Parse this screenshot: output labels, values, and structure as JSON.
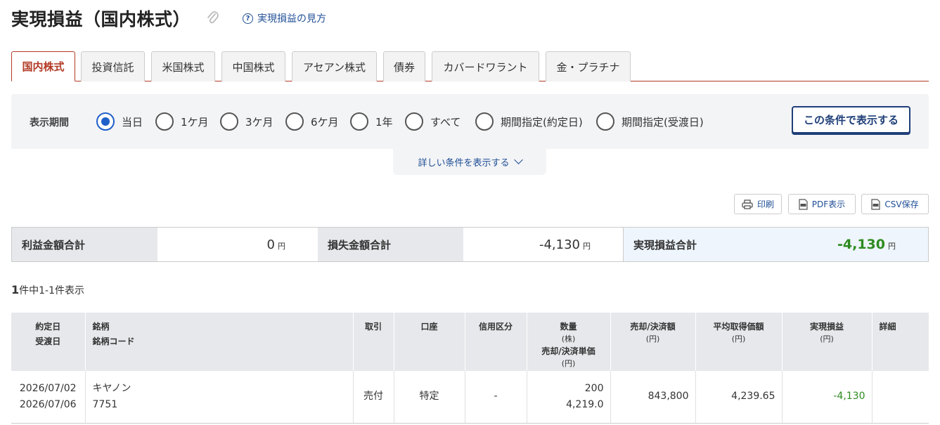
{
  "page": {
    "title": "実現損益（国内株式）",
    "help_link": "実現損益の見方"
  },
  "tabs": [
    {
      "label": "国内株式",
      "active": true
    },
    {
      "label": "投資信託",
      "active": false
    },
    {
      "label": "米国株式",
      "active": false
    },
    {
      "label": "中国株式",
      "active": false
    },
    {
      "label": "アセアン株式",
      "active": false
    },
    {
      "label": "債券",
      "active": false
    },
    {
      "label": "カバードワラント",
      "active": false
    },
    {
      "label": "金・プラチナ",
      "active": false
    }
  ],
  "filter": {
    "label": "表示期間",
    "options": [
      {
        "label": "当日",
        "checked": true
      },
      {
        "label": "1ケ月",
        "checked": false
      },
      {
        "label": "3ケ月",
        "checked": false
      },
      {
        "label": "6ケ月",
        "checked": false
      },
      {
        "label": "1年",
        "checked": false
      },
      {
        "label": "すべて",
        "checked": false
      },
      {
        "label": "期間指定(約定日)",
        "checked": false
      },
      {
        "label": "期間指定(受渡日)",
        "checked": false
      }
    ],
    "submit_label": "この条件で表示する",
    "more_label": "詳しい条件を表示する"
  },
  "tools": {
    "print": "印刷",
    "pdf": "PDF表示",
    "csv": "CSV保存"
  },
  "summary": {
    "profit_label": "利益金額合計",
    "profit_value": "0",
    "loss_label": "損失金額合計",
    "loss_value": "-4,130",
    "total_label": "実現損益合計",
    "total_value": "-4,130",
    "unit": "円"
  },
  "count": {
    "total": "1",
    "text": "件中1-1件表示"
  },
  "table": {
    "headers": {
      "date1": "約定日",
      "date2": "受渡日",
      "name1": "銘柄",
      "name2": "銘柄コード",
      "trade": "取引",
      "account": "口座",
      "margin": "信用区分",
      "qty1": "数量",
      "qty_unit": "(株)",
      "qty2": "売却/決済単価",
      "qty2_unit": "(円)",
      "amount": "売却/決済額",
      "amount_unit": "(円)",
      "avg": "平均取得価額",
      "avg_unit": "(円)",
      "pnl": "実現損益",
      "pnl_unit": "(円)",
      "detail": "詳細"
    },
    "rows": [
      {
        "trade_date": "2026/07/02",
        "settle_date": "2026/07/06",
        "name": "キヤノン",
        "code": "7751",
        "trade": "売付",
        "account": "特定",
        "margin": "-",
        "quantity": "200",
        "unit_price": "4,219.0",
        "amount": "843,800",
        "avg_cost": "4,239.65",
        "pnl": "-4,130",
        "detail": ""
      }
    ]
  },
  "colors": {
    "accent_red": "#b23a25",
    "link_blue": "#1f4e96",
    "radio_blue": "#1f5fc9",
    "loss_green": "#2e8b1f"
  }
}
